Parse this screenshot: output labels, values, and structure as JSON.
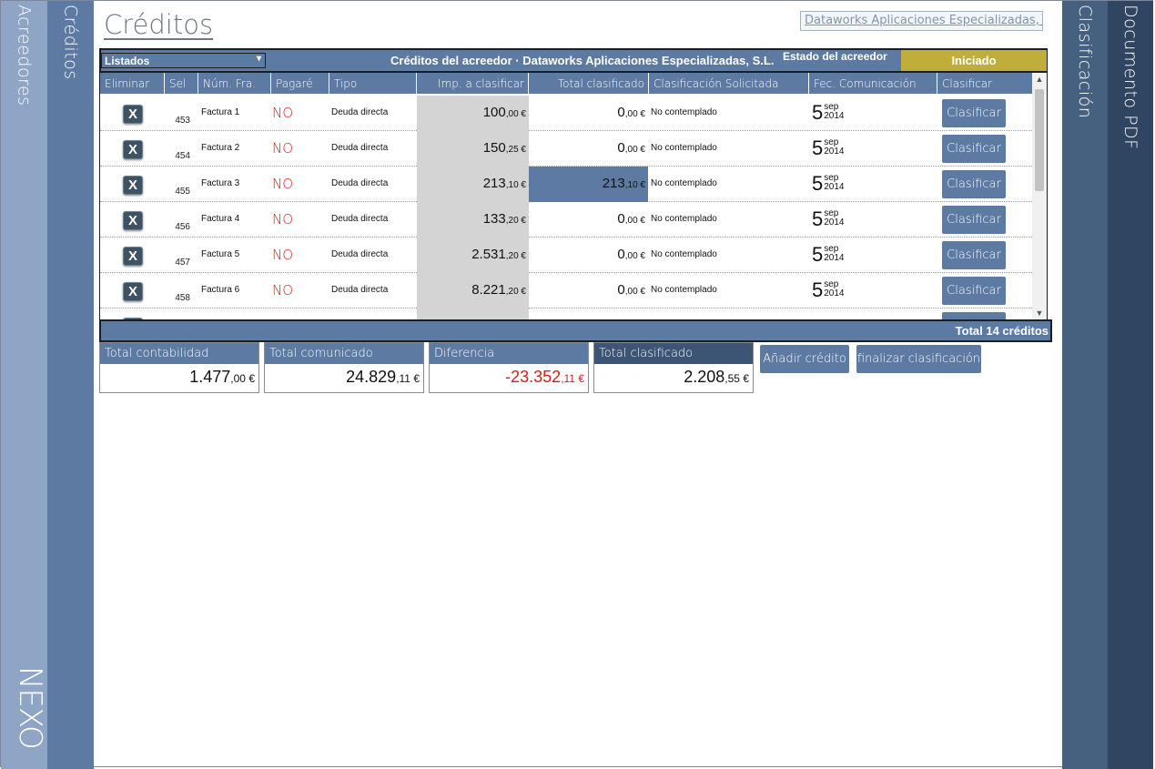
{
  "nav": {
    "acreedores": "Acreedores",
    "creditos": "Créditos",
    "clasificacion": "Clasificación",
    "documento_pdf": "Documento PDF",
    "logo": "NEXO"
  },
  "page": {
    "title": "Créditos",
    "creditor_chip": "Dataworks Aplicaciones Especializadas, SL"
  },
  "header": {
    "dropdown_value": "Listados",
    "title": "Créditos del acreedor · Dataworks Aplicaciones Especializadas, S.L.",
    "estado_label": "Estado del acreedor",
    "estado_value": "Iniciado"
  },
  "columns": [
    "Eliminar",
    "Sel",
    "Núm. Fra.",
    "Pagaré",
    "Tipo",
    "Imp. a clasificar",
    "Total clasificado",
    "Clasificación Solicitada",
    "Fec. Comunicación",
    "Clasificar"
  ],
  "rows": [
    {
      "eliminar": "X",
      "sel": "453",
      "fra": "Factura 1",
      "pagare": "NO",
      "tipo": "Deuda directa",
      "imp_int": "100",
      "imp_dec": ",00 €",
      "tot_int": "0",
      "tot_dec": ",00 €",
      "clasif": "No contemplado",
      "day": "5",
      "month": "sep",
      "year": "2014",
      "btn": "Clasificar",
      "highlight": false
    },
    {
      "eliminar": "X",
      "sel": "454",
      "fra": "Factura 2",
      "pagare": "NO",
      "tipo": "Deuda directa",
      "imp_int": "150",
      "imp_dec": ",25 €",
      "tot_int": "0",
      "tot_dec": ",00 €",
      "clasif": "No contemplado",
      "day": "5",
      "month": "sep",
      "year": "2014",
      "btn": "Clasificar",
      "highlight": false
    },
    {
      "eliminar": "X",
      "sel": "455",
      "fra": "Factura 3",
      "pagare": "NO",
      "tipo": "Deuda directa",
      "imp_int": "213",
      "imp_dec": ",10 €",
      "tot_int": "213",
      "tot_dec": ",10 €",
      "clasif": "No contemplado",
      "day": "5",
      "month": "sep",
      "year": "2014",
      "btn": "Clasificar",
      "highlight": true
    },
    {
      "eliminar": "X",
      "sel": "456",
      "fra": "Factura 4",
      "pagare": "NO",
      "tipo": "Deuda directa",
      "imp_int": "133",
      "imp_dec": ",20 €",
      "tot_int": "0",
      "tot_dec": ",00 €",
      "clasif": "No contemplado",
      "day": "5",
      "month": "sep",
      "year": "2014",
      "btn": "Clasificar",
      "highlight": false
    },
    {
      "eliminar": "X",
      "sel": "457",
      "fra": "Factura 5",
      "pagare": "NO",
      "tipo": "Deuda directa",
      "imp_int": "2.531",
      "imp_dec": ",20 €",
      "tot_int": "0",
      "tot_dec": ",00 €",
      "clasif": "No contemplado",
      "day": "5",
      "month": "sep",
      "year": "2014",
      "btn": "Clasificar",
      "highlight": false
    },
    {
      "eliminar": "X",
      "sel": "458",
      "fra": "Factura 6",
      "pagare": "NO",
      "tipo": "Deuda directa",
      "imp_int": "8.221",
      "imp_dec": ",20 €",
      "tot_int": "0",
      "tot_dec": ",00 €",
      "clasif": "No contemplado",
      "day": "5",
      "month": "sep",
      "year": "2014",
      "btn": "Clasificar",
      "highlight": false
    }
  ],
  "footer": {
    "total_creditos": "Total 14 créditos"
  },
  "totals": {
    "contabilidad_label": "Total contabilidad",
    "contabilidad_int": "1.477",
    "contabilidad_dec": ",00 €",
    "comunicado_label": "Total comunicado",
    "comunicado_int": "24.829",
    "comunicado_dec": ",11 €",
    "diferencia_label": "Diferencia",
    "diferencia_int": "-23.352",
    "diferencia_dec": ",11 €",
    "clasificado_label": "Total clasificado",
    "clasificado_int": "2.208",
    "clasificado_dec": ",55 €"
  },
  "actions": {
    "add": "Añadir crédito",
    "finish": "finalizar clasificación"
  },
  "colors": {
    "accent": "#5d7aa3",
    "estado": "#bfae3a",
    "negative": "#d81d1d",
    "pagare_no": "#e21a1a"
  }
}
